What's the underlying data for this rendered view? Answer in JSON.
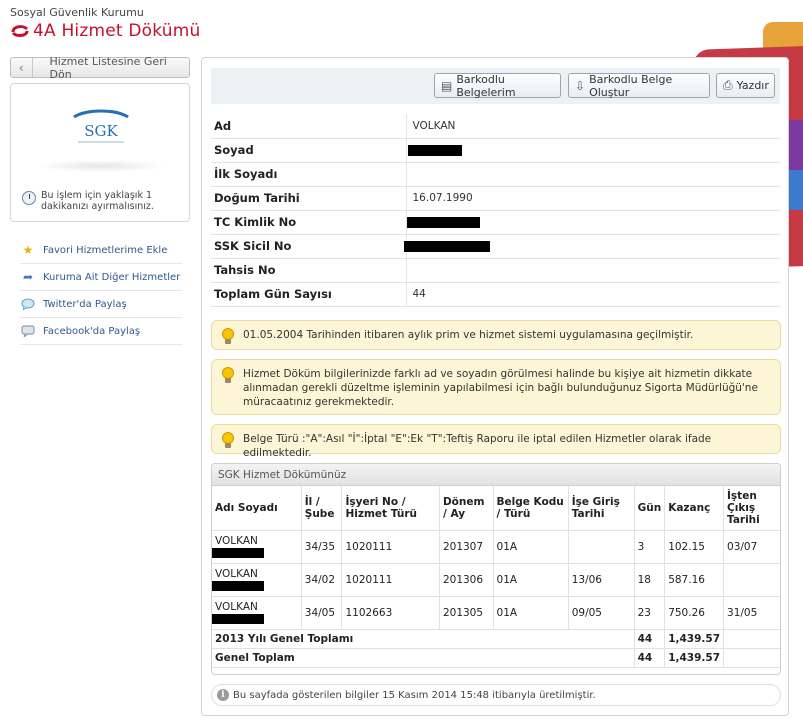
{
  "header": {
    "org": "Sosyal Güvenlik Kurumu",
    "title": "4A Hizmet Dökümü"
  },
  "sidebar": {
    "back_label": "Hizmet Listesine Geri Dön",
    "logo_text": "SGK",
    "time_note_line1": "Bu işlem için yaklaşık 1",
    "time_note_line2": "dakikanızı ayırmalısınız.",
    "links": [
      {
        "label": "Favori Hizmetlerime Ekle",
        "icon": "star-icon"
      },
      {
        "label": "Kuruma Ait Diğer Hizmetler",
        "icon": "arrow-icon"
      },
      {
        "label": "Twitter'da Paylaş",
        "icon": "twitter-icon"
      },
      {
        "label": "Facebook'da Paylaş",
        "icon": "facebook-icon"
      }
    ]
  },
  "toolbar": {
    "barcoded_docs": "Barkodlu Belgelerim",
    "create_barcoded": "Barkodlu Belge Oluştur",
    "print": "Yazdır"
  },
  "person": {
    "rows": [
      {
        "label": "Ad",
        "value": "VOLKAN"
      },
      {
        "label": "Soyad",
        "value": ""
      },
      {
        "label": "İlk Soyadı",
        "value": ""
      },
      {
        "label": "Doğum Tarihi",
        "value": "16.07.1990"
      },
      {
        "label": "TC Kimlik No",
        "value": ""
      },
      {
        "label": "SSK Sicil No",
        "value": ""
      },
      {
        "label": "Tahsis No",
        "value": ""
      },
      {
        "label": "Toplam Gün Sayısı",
        "value": "44"
      }
    ]
  },
  "notices": [
    "01.05.2004 Tarihinden itibaren aylık prim ve hizmet sistemi uygulamasına geçilmiştir.",
    "Hizmet Döküm bilgilerinizde farklı ad ve soyadın görülmesi halinde bu kişiye ait hizmetin dikkate alınmadan gerekli düzeltme işleminin yapılabilmesi için bağlı bulunduğunuz Sigorta Müdürlüğü'ne müracaatınız gerekmektedir.",
    "Belge Türü :\"A\":Asıl \"İ\":İptal \"E\":Ek \"T\":Teftiş Raporu ile iptal edilen Hizmetler olarak ifade edilmektedir."
  ],
  "grid": {
    "title": "SGK Hizmet Dökümünüz",
    "columns": [
      "Adı Soyadı",
      "İl / Şube",
      "İşyeri No / Hizmet Türü",
      "Dönem / Ay",
      "Belge Kodu / Türü",
      "İşe Giriş Tarihi",
      "Gün",
      "Kazanç",
      "İşten Çıkış Tarihi"
    ],
    "rows": [
      {
        "name": "VOLKAN",
        "il": "34/35",
        "isyeri": "1020111",
        "donem": "201307",
        "belge": "01A",
        "giris": "",
        "gun": "3",
        "kazanc": "102.15",
        "cikis": "03/07"
      },
      {
        "name": "VOLKAN",
        "il": "34/02",
        "isyeri": "1020111",
        "donem": "201306",
        "belge": "01A",
        "giris": "13/06",
        "gun": "18",
        "kazanc": "587.16",
        "cikis": ""
      },
      {
        "name": "VOLKAN",
        "il": "34/05",
        "isyeri": "1102663",
        "donem": "201305",
        "belge": "01A",
        "giris": "09/05",
        "gun": "23",
        "kazanc": "750.26",
        "cikis": "31/05"
      }
    ],
    "year_total_label": "2013 Yılı Genel Toplamı",
    "year_total_gun": "44",
    "year_total_kazanc": "1,439.57",
    "grand_total_label": "Genel Toplam",
    "grand_total_gun": "44",
    "grand_total_kazanc": "1,439.57"
  },
  "footer": "Bu sayfada gösterilen bilgiler 15 Kasım 2014 15:48 itibarıyla üretilmiştir."
}
